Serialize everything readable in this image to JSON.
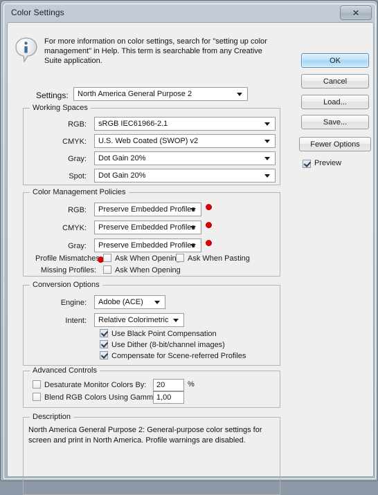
{
  "window": {
    "title": "Color Settings",
    "close_icon": "close-icon",
    "close_glyph": "✕"
  },
  "info": {
    "icon": "info-icon",
    "text": "For more information on color settings, search for \"setting up color management\" in Help. This term is searchable from any Creative Suite application."
  },
  "settings": {
    "label": "Settings:",
    "value": "North America General Purpose 2"
  },
  "working_spaces": {
    "title": "Working Spaces",
    "rows": [
      {
        "label": "RGB:",
        "value": "sRGB IEC61966-2.1"
      },
      {
        "label": "CMYK:",
        "value": "U.S. Web Coated (SWOP) v2"
      },
      {
        "label": "Gray:",
        "value": "Dot Gain 20%"
      },
      {
        "label": "Spot:",
        "value": "Dot Gain 20%"
      }
    ]
  },
  "policies": {
    "title": "Color Management Policies",
    "rows": [
      {
        "label": "RGB:",
        "value": "Preserve Embedded Profiles"
      },
      {
        "label": "CMYK:",
        "value": "Preserve Embedded Profiles"
      },
      {
        "label": "Gray:",
        "value": "Preserve Embedded Profiles"
      }
    ],
    "mismatch_label": "Profile Mismatches:",
    "mismatch_open": "Ask When Opening",
    "mismatch_paste": "Ask When Pasting",
    "missing_label": "Missing Profiles:",
    "missing_open": "Ask When Opening",
    "warn_color": "#e00000"
  },
  "conversion": {
    "title": "Conversion Options",
    "engine_label": "Engine:",
    "engine_value": "Adobe (ACE)",
    "intent_label": "Intent:",
    "intent_value": "Relative Colorimetric",
    "checks": [
      "Use Black Point Compensation",
      "Use Dither (8-bit/channel images)",
      "Compensate for Scene-referred Profiles"
    ]
  },
  "advanced": {
    "title": "Advanced Controls",
    "desaturate_label": "Desaturate Monitor Colors By:",
    "desaturate_value": "20",
    "percent": "%",
    "blend_label": "Blend RGB Colors Using Gamma:",
    "blend_value": "1,00"
  },
  "description": {
    "title": "Description",
    "text": "North America General Purpose 2:  General-purpose color settings for screen and print in North America. Profile warnings are disabled."
  },
  "buttons": {
    "ok": "OK",
    "cancel": "Cancel",
    "load": "Load...",
    "save": "Save...",
    "fewer": "Fewer Options",
    "preview": "Preview",
    "accent": "#a4d6f3"
  }
}
